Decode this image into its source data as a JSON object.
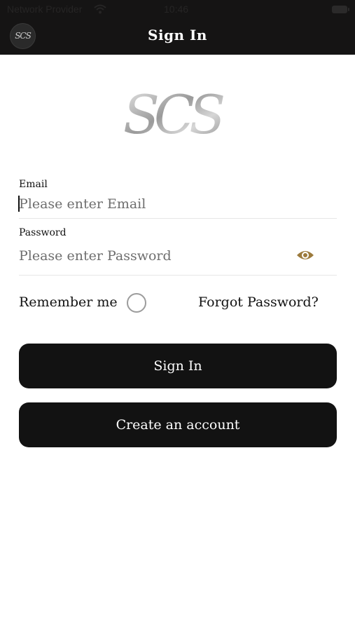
{
  "status_bar": {
    "carrier": "Network Provider",
    "time": "10:46"
  },
  "header": {
    "logo_text": "SCS",
    "title": "Sign In"
  },
  "brand": {
    "logo_text": "SCS"
  },
  "form": {
    "email": {
      "label": "Email",
      "placeholder": "Please enter Email",
      "value": ""
    },
    "password": {
      "label": "Password",
      "placeholder": "Please enter Password",
      "value": ""
    },
    "remember_label": "Remember me",
    "remember_checked": false,
    "forgot_label": "Forgot Password?"
  },
  "actions": {
    "sign_in_label": "Sign In",
    "create_account_label": "Create an account"
  },
  "colors": {
    "header_bg": "#151414",
    "button_bg": "#121212",
    "accent_eye": "#9c7a3c"
  },
  "icons": {
    "wifi": "wifi-icon",
    "battery": "battery-icon",
    "eye": "eye-icon"
  }
}
